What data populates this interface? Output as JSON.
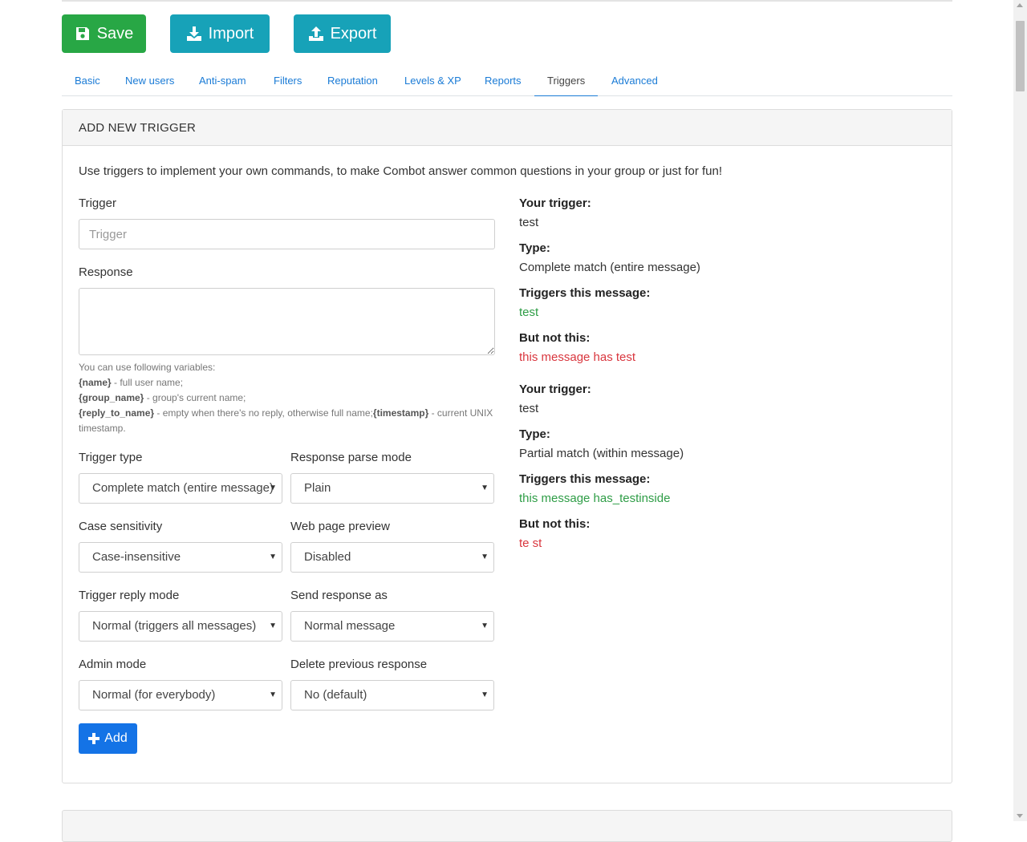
{
  "toolbar": {
    "save_label": "Save",
    "import_label": "Import",
    "export_label": "Export",
    "colors": {
      "save": "#28a745",
      "import": "#17a2b8",
      "export": "#17a2b8"
    }
  },
  "tabs": [
    {
      "label": "Basic",
      "active": false
    },
    {
      "label": "New users",
      "active": false
    },
    {
      "label": "Anti-spam",
      "active": false
    },
    {
      "label": "Filters",
      "active": false
    },
    {
      "label": "Reputation",
      "active": false
    },
    {
      "label": "Levels & XP",
      "active": false
    },
    {
      "label": "Reports",
      "active": false
    },
    {
      "label": "Triggers",
      "active": true
    },
    {
      "label": "Advanced",
      "active": false
    }
  ],
  "card": {
    "title": "ADD NEW TRIGGER",
    "intro": "Use triggers to implement your own commands, to make Combot answer common questions in your group or just for fun!"
  },
  "form": {
    "trigger_label": "Trigger",
    "trigger_placeholder": "Trigger",
    "trigger_value": "",
    "response_label": "Response",
    "response_value": "",
    "help": {
      "intro": "You can use following variables:",
      "var_name": "{name}",
      "var_name_desc": " - full user name;",
      "var_group": "{group_name}",
      "var_group_desc": " - group's current name;",
      "var_reply": "{reply_to_name}",
      "var_reply_desc": " - empty when there's no reply, otherwise full name;",
      "var_timestamp": "{timestamp}",
      "var_timestamp_desc": " - current UNIX timestamp."
    },
    "trigger_type_label": "Trigger type",
    "trigger_type_value": "Complete match (entire message)",
    "parse_mode_label": "Response parse mode",
    "parse_mode_value": "Plain",
    "case_label": "Case sensitivity",
    "case_value": "Case-insensitive",
    "preview_label": "Web page preview",
    "preview_value": "Disabled",
    "reply_mode_label": "Trigger reply mode",
    "reply_mode_value": "Normal (triggers all messages)",
    "send_as_label": "Send response as",
    "send_as_value": "Normal message",
    "admin_mode_label": "Admin mode",
    "admin_mode_value": "Normal (for everybody)",
    "delete_prev_label": "Delete previous response",
    "delete_prev_value": "No (default)",
    "add_label": "Add",
    "add_color": "#1473e6"
  },
  "examples": [
    {
      "trigger_heading": "Your trigger:",
      "trigger": "test",
      "type_heading": "Type:",
      "type": "Complete match (entire message)",
      "matches_heading": "Triggers this message:",
      "matches": "test",
      "not_heading": "But not this:",
      "not": "this message has test"
    },
    {
      "trigger_heading": "Your trigger:",
      "trigger": "test",
      "type_heading": "Type:",
      "type": "Partial match (within message)",
      "matches_heading": "Triggers this message:",
      "matches": "this message has_testinside",
      "not_heading": "But not this:",
      "not": "te st"
    }
  ],
  "status_colors": {
    "match": "#2e9d46",
    "no_match": "#d9363e"
  }
}
